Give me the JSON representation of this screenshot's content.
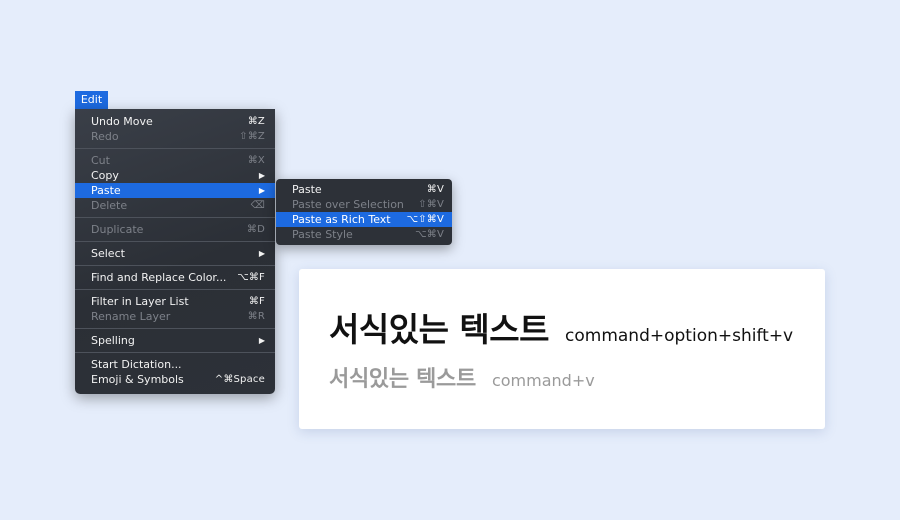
{
  "edit_menu": {
    "title": "Edit",
    "items": [
      {
        "label": "Undo Move",
        "shortcut": "⌘Z"
      },
      {
        "label": "Redo",
        "shortcut": "⇧⌘Z"
      },
      {
        "label": "Cut",
        "shortcut": "⌘X"
      },
      {
        "label": "Copy",
        "shortcut": "▶"
      },
      {
        "label": "Paste",
        "shortcut": "▶"
      },
      {
        "label": "Delete",
        "shortcut": "⌫"
      },
      {
        "label": "Duplicate",
        "shortcut": "⌘D"
      },
      {
        "label": "Select",
        "shortcut": "▶"
      },
      {
        "label": "Find and Replace Color...",
        "shortcut": "⌥⌘F"
      },
      {
        "label": "Filter in Layer List",
        "shortcut": "⌘F"
      },
      {
        "label": "Rename Layer",
        "shortcut": "⌘R"
      },
      {
        "label": "Spelling",
        "shortcut": "▶"
      },
      {
        "label": "Start Dictation...",
        "shortcut": ""
      },
      {
        "label": "Emoji & Symbols",
        "shortcut": "^⌘Space"
      }
    ]
  },
  "paste_submenu": {
    "items": [
      {
        "label": "Paste",
        "shortcut": "⌘V"
      },
      {
        "label": "Paste over Selection",
        "shortcut": "⇧⌘V"
      },
      {
        "label": "Paste as Rich Text",
        "shortcut": "⌥⇧⌘V"
      },
      {
        "label": "Paste Style",
        "shortcut": "⌥⌘V"
      }
    ]
  },
  "example_card": {
    "rich_text_korean": "서식있는 텍스트",
    "rich_text_shortcut": "command+option+shift+v",
    "plain_text_korean": "서식있는 텍스트",
    "plain_text_shortcut": "command+v"
  },
  "colors": {
    "background": "#e5edfb",
    "highlight": "#1d6ae0",
    "menu_bg": "#2d3138"
  }
}
